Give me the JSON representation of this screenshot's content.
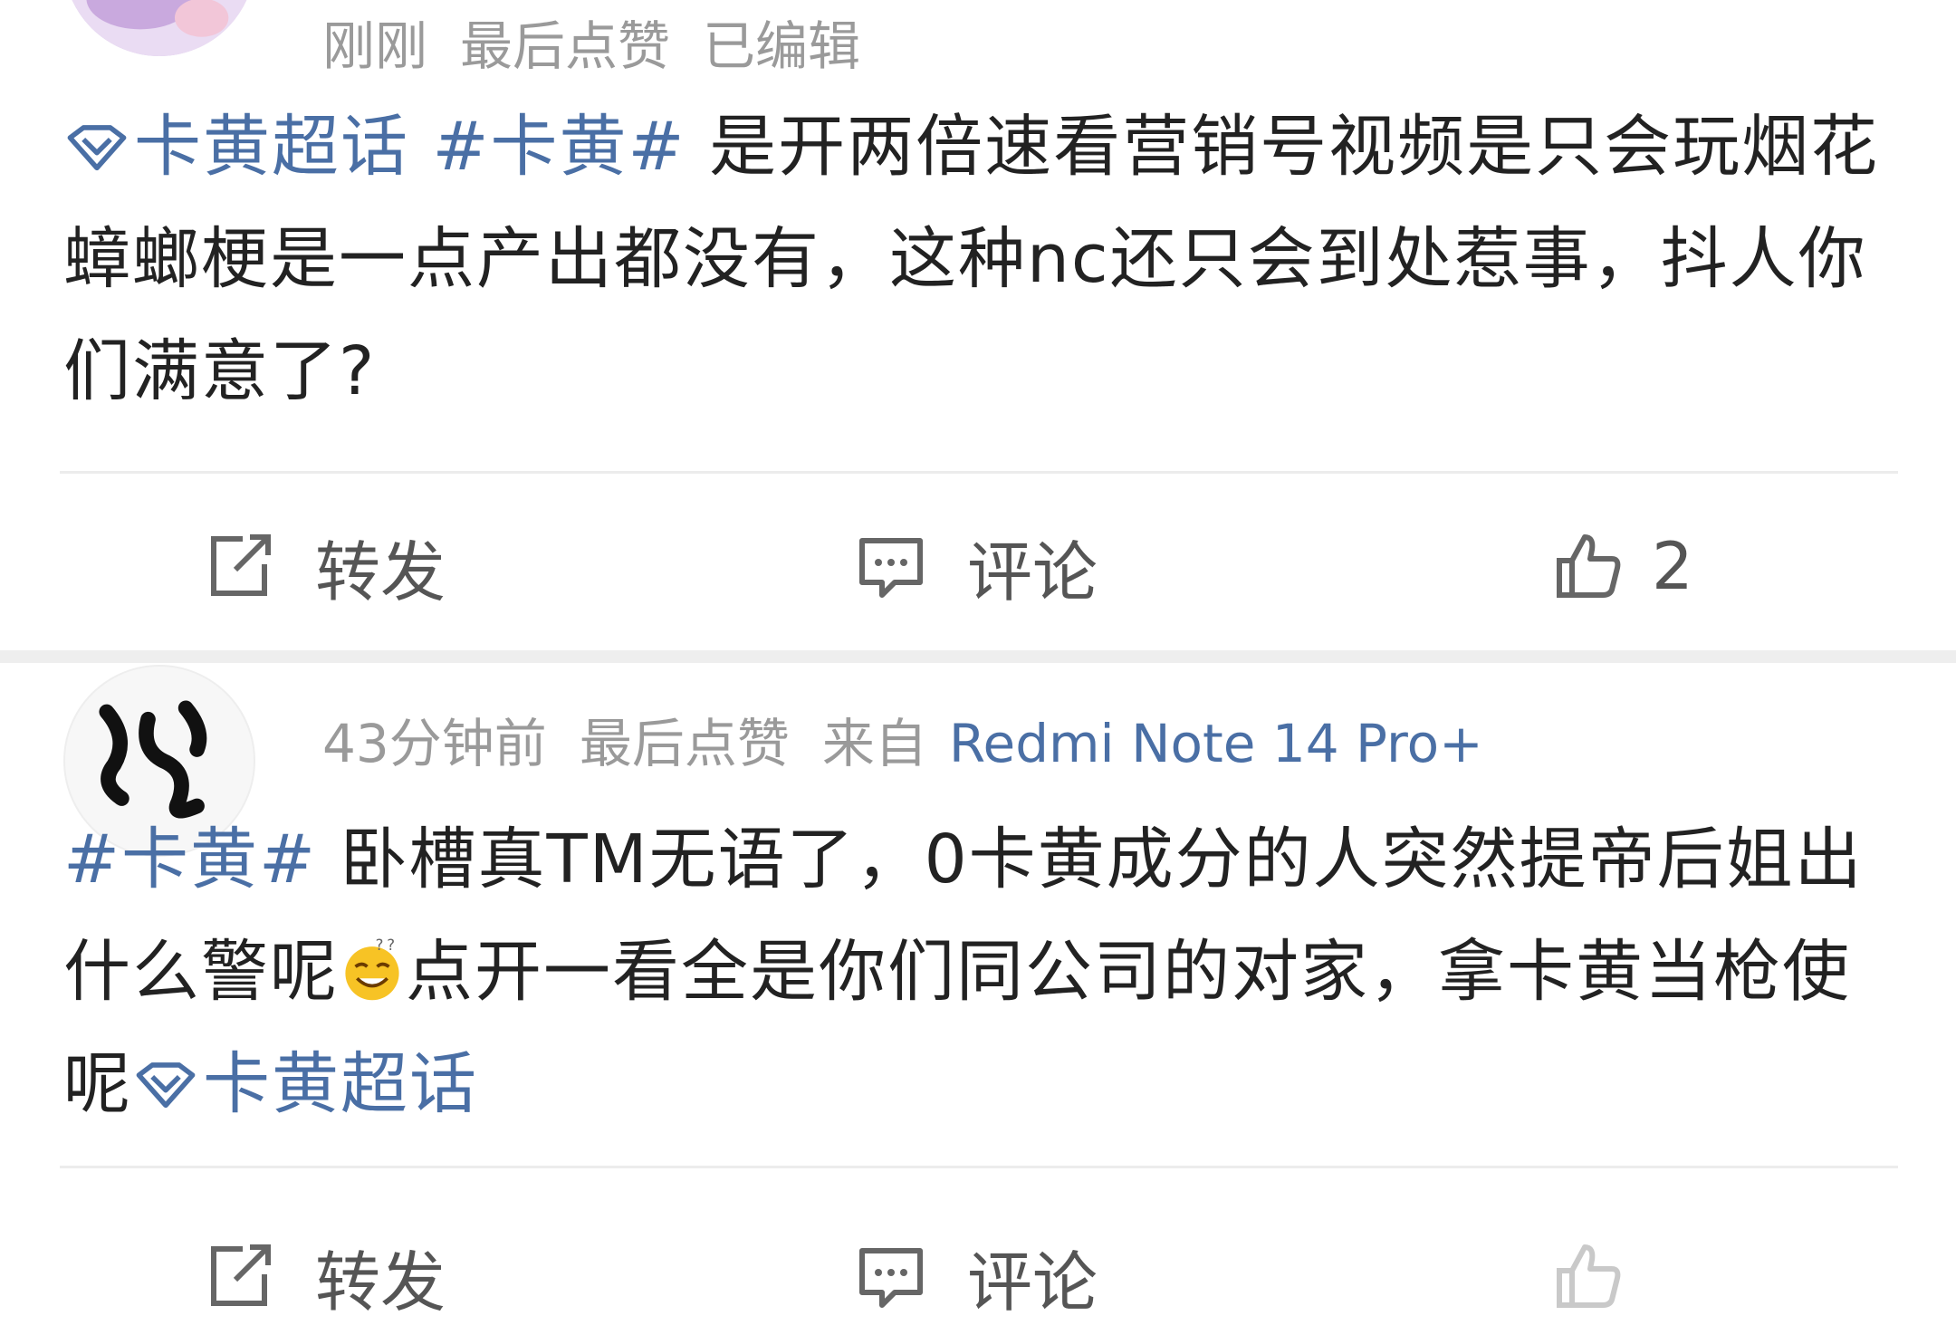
{
  "posts": [
    {
      "time": "刚刚",
      "last_like": "最后点赞",
      "edited": "已编辑",
      "content": {
        "supertopic": "卡黄超话",
        "hashtag": "#卡黄#",
        "text": " 是开两倍速看营销号视频是只会玩烟花蟑螂梗是一点产出都没有，这种nc还只会到处惹事，抖人你们满意了?"
      },
      "actions": {
        "repost": "转发",
        "comment": "评论",
        "like_count": "2"
      }
    },
    {
      "time": "43分钟前",
      "last_like": "最后点赞",
      "source_prefix": "来自",
      "device": "Redmi Note 14 Pro+",
      "content": {
        "hashtag": "#卡黄#",
        "text_before_emoji": " 卧槽真TM无语了，0卡黄成分的人突然提帝后姐出什么警呢",
        "emoji": "dizzy-smile-emoji",
        "text_after_emoji": "点开一看全是你们同公司的对家，拿卡黄当枪使呢",
        "supertopic": "卡黄超话"
      },
      "actions": {
        "repost": "转发",
        "comment": "评论"
      }
    }
  ],
  "colors": {
    "link": "#4a6fa5",
    "meta": "#9a9a9a",
    "text": "#222222",
    "separator": "#eeeeee"
  }
}
